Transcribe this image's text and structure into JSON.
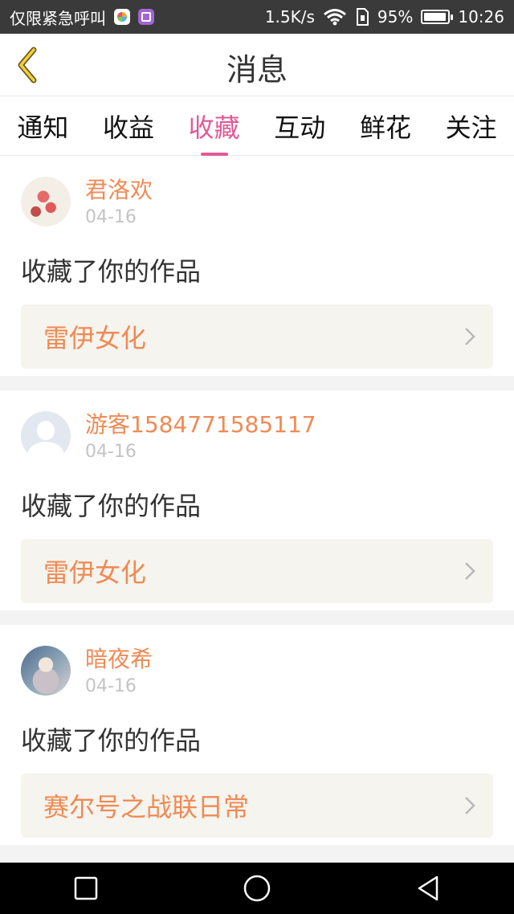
{
  "status_bar": {
    "left_text": "仅限紧急呼叫",
    "speed": "1.5K/s",
    "battery": "95%",
    "battery_level": 0.95,
    "time": "10:26"
  },
  "header": {
    "title": "消息"
  },
  "tabs": [
    {
      "label": "通知",
      "active": false
    },
    {
      "label": "收益",
      "active": false
    },
    {
      "label": "收藏",
      "active": true
    },
    {
      "label": "互动",
      "active": false
    },
    {
      "label": "鲜花",
      "active": false
    },
    {
      "label": "关注",
      "active": false
    }
  ],
  "colors": {
    "accent": "#e25a96",
    "username": "#f08a54",
    "work_bg": "#f5f4ee"
  },
  "messages": [
    {
      "user": "君洛欢",
      "date": "04-16",
      "action": "收藏了你的作品",
      "work": "雷伊女化"
    },
    {
      "user": "游客1584771585117",
      "date": "04-16",
      "action": "收藏了你的作品",
      "work": "雷伊女化"
    },
    {
      "user": "暗夜希",
      "date": "04-16",
      "action": "收藏了你的作品",
      "work": "赛尔号之战联日常"
    }
  ]
}
